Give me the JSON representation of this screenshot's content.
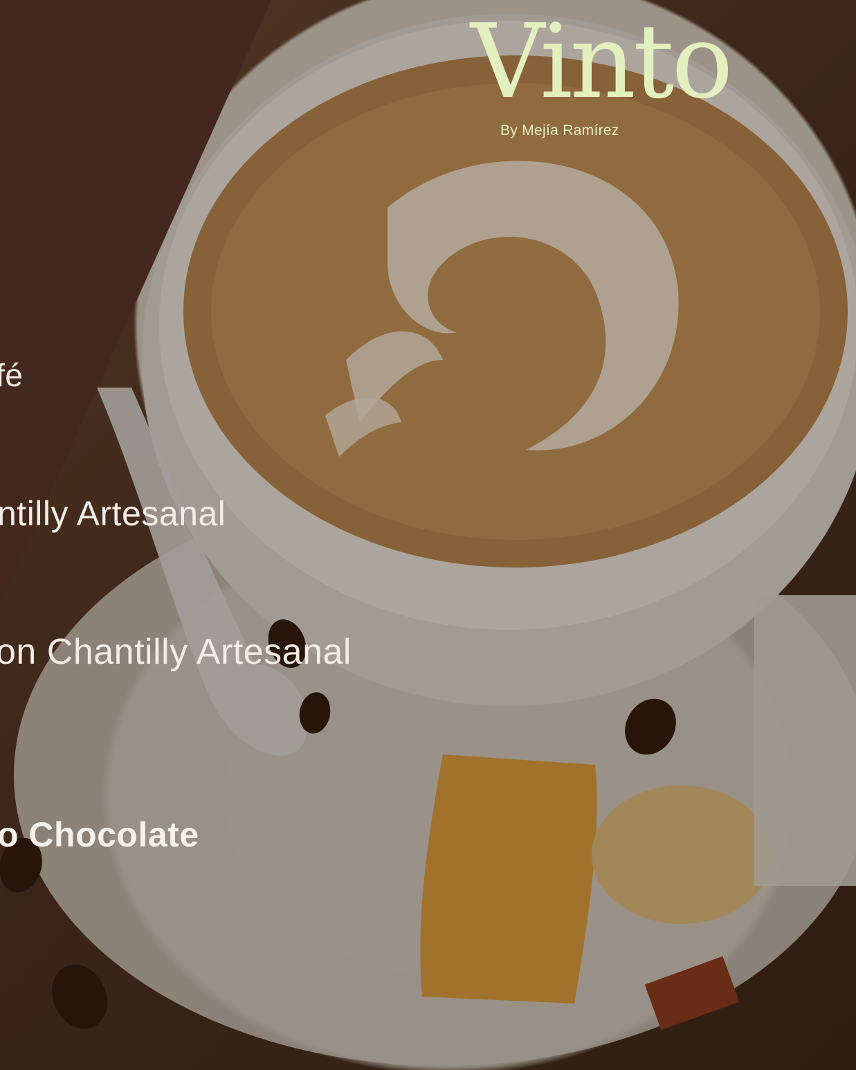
{
  "brand": {
    "name": "Vinto",
    "byline": "By Mejía Ramírez",
    "color": "#e4efbf"
  },
  "panel": {
    "color": "#43281f"
  },
  "menu": {
    "items": [
      {
        "label": "fé"
      },
      {
        "label": "ntilly Artesanal"
      },
      {
        "label": "on Chantilly Artesanal"
      },
      {
        "label": "o Chocolate",
        "highlighted": true
      }
    ]
  }
}
